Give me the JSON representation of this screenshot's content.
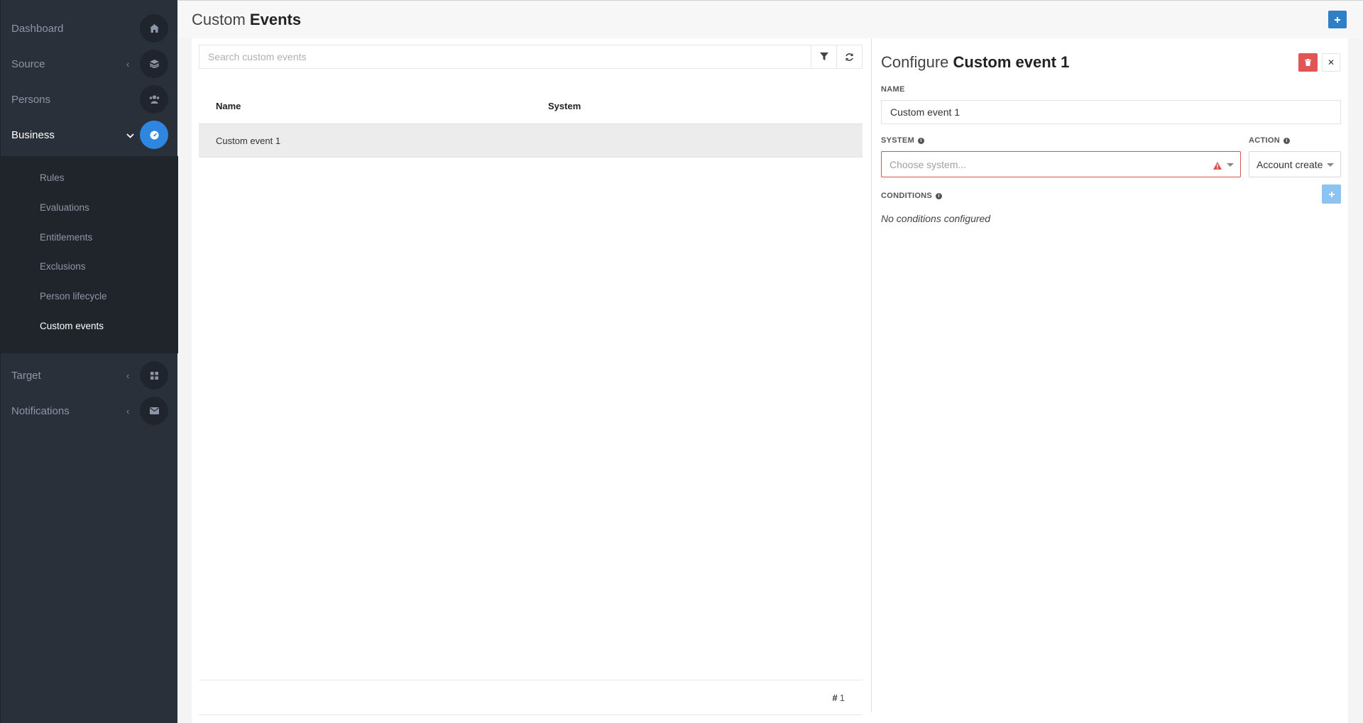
{
  "sidebar": {
    "items": [
      {
        "label": "Dashboard",
        "icon": "home-icon"
      },
      {
        "label": "Source",
        "icon": "layers-icon"
      },
      {
        "label": "Persons",
        "icon": "users-icon"
      },
      {
        "label": "Business",
        "icon": "gauge-icon"
      },
      {
        "label": "Target",
        "icon": "grid-icon"
      },
      {
        "label": "Notifications",
        "icon": "envelope-icon"
      }
    ],
    "business_submenu": [
      "Rules",
      "Evaluations",
      "Entitlements",
      "Exclusions",
      "Person lifecycle",
      "Custom events"
    ],
    "active_item": "Business",
    "active_subitem": "Custom events"
  },
  "header": {
    "title_light": "Custom",
    "title_bold": "Events",
    "add_label": "+"
  },
  "list": {
    "search_placeholder": "Search custom events",
    "columns": [
      "Name",
      "System"
    ],
    "rows": [
      {
        "name": "Custom event 1",
        "system": ""
      }
    ],
    "footer_hash": "#",
    "footer_count": "1"
  },
  "config": {
    "title_light": "Configure",
    "title_bold": "Custom event 1",
    "name_label": "NAME",
    "name_value": "Custom event 1",
    "system_label": "SYSTEM",
    "system_placeholder": "Choose system...",
    "action_label": "ACTION",
    "action_value": "Account create",
    "conditions_label": "CONDITIONS",
    "conditions_empty": "No conditions configured",
    "close_label": "✕",
    "info_glyph": "i"
  },
  "colors": {
    "sidebar_bg": "#2a303a",
    "active_accent": "#2f86e0",
    "error": "#d9534f",
    "delete": "#e05555"
  }
}
